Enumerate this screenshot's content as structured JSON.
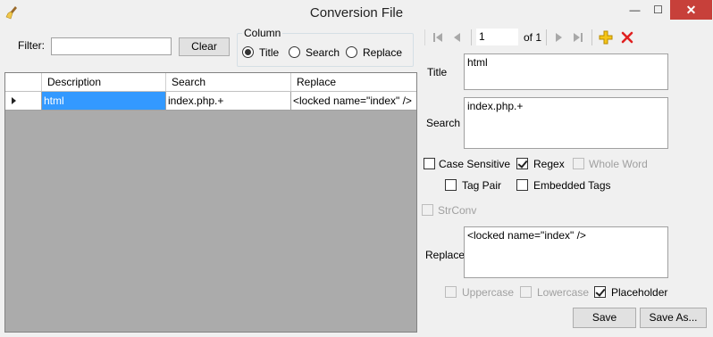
{
  "window": {
    "title": "Conversion File",
    "minimize_symbol": "—",
    "maximize_symbol": "☐",
    "close_symbol": "✕",
    "app_icon": "broom-icon"
  },
  "filter": {
    "label": "Filter:",
    "value": "",
    "clear_label": "Clear"
  },
  "column": {
    "label": "Column",
    "options": [
      {
        "label": "Title",
        "checked": true
      },
      {
        "label": "Search",
        "checked": false
      },
      {
        "label": "Replace",
        "checked": false
      }
    ]
  },
  "grid": {
    "columns": [
      "Description",
      "Search",
      "Replace"
    ],
    "rows": [
      {
        "description": "html",
        "search": "index.php.+",
        "replace": "<locked name=\"index\" />"
      }
    ]
  },
  "navigator": {
    "position": "1",
    "of_label": "of 1",
    "icons": [
      "first-icon",
      "previous-icon",
      "next-icon",
      "last-icon",
      "add-icon",
      "delete-icon"
    ],
    "add_color": "#e8a800",
    "delete_color": "#e02020"
  },
  "form": {
    "title_label": "Title",
    "title_value": "html",
    "search_label": "Search",
    "search_value": "index.php.+",
    "case_sensitive_label": "Case Sensitive",
    "regex_label": "Regex",
    "whole_word_label": "Whole Word",
    "tag_pair_label": "Tag Pair",
    "embedded_tags_label": "Embedded Tags",
    "strconv_label": "StrConv",
    "replace_label": "Replace",
    "replace_value": "<locked name=\"index\" />",
    "uppercase_label": "Uppercase",
    "lowercase_label": "Lowercase",
    "placeholder_label": "Placeholder",
    "save_label": "Save",
    "save_as_label": "Save As..."
  },
  "colors": {
    "selection": "#3399ff",
    "grid_background": "#ababab",
    "close_button": "#c7403a"
  }
}
